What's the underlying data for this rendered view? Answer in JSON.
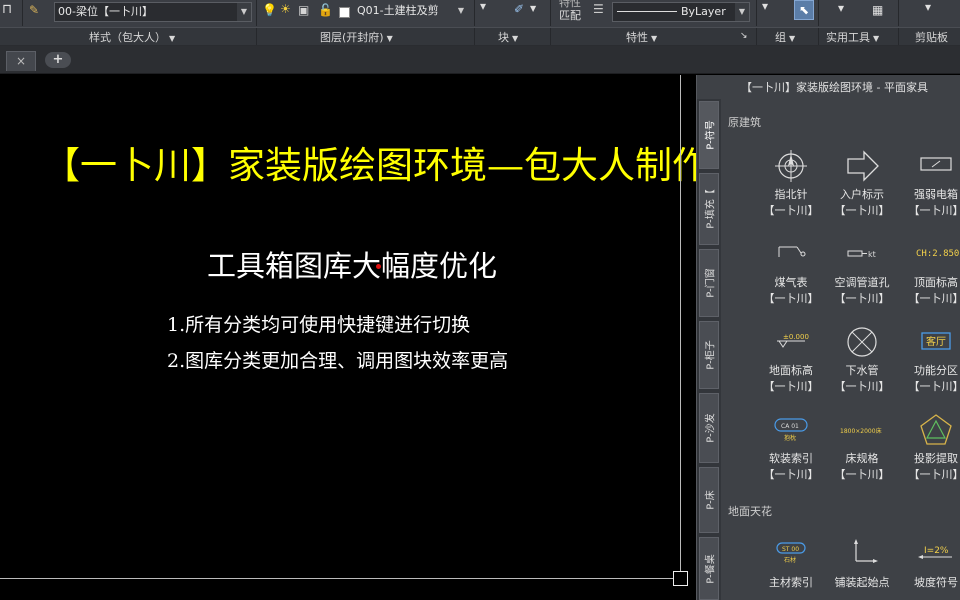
{
  "ribbon": {
    "style_combo": "00-梁位【一卜川】",
    "layer_combo": "Q01-土建柱及剪",
    "bylayer_combo": "ByLayer",
    "match_text1": "特性",
    "match_text2": "匹配",
    "groups": {
      "style": "样式（包大人）",
      "layers": "图层(开封府)",
      "block": "块",
      "properties": "特性",
      "group": "组",
      "utilities": "实用工具",
      "clipboard": "剪贴板"
    }
  },
  "tabs": {
    "close_glyph": "×",
    "add_glyph": "+"
  },
  "canvas": {
    "title": "【一卜川】家装版绘图环境—包大人制作",
    "subtitle": "工具箱图库大幅度优化",
    "lines": [
      "1.所有分类均可使用快捷键进行切换",
      "2.图库分类更加合理、调用图块效率更高"
    ],
    "colors": {
      "title": "#ffff00",
      "body": "#ffffff",
      "background": "#000000"
    }
  },
  "palette": {
    "title": "【一卜川】家装版绘图环境 - 平面家具",
    "vertical_tabs": [
      "P-符号",
      "P-填充【",
      "P-门窗",
      "P-柜子",
      "P-沙发",
      "P-床",
      "P-餐桌"
    ],
    "sections": [
      {
        "label": "原建筑",
        "tools": [
          {
            "name": "指北针",
            "tag": "【一卜川】",
            "icon": "compass-icon"
          },
          {
            "name": "入户标示",
            "tag": "【一卜川】",
            "icon": "arrow-right-icon"
          },
          {
            "name": "强弱电箱",
            "tag": "【一卜川】",
            "icon": "electric-box-icon"
          },
          {
            "name": "煤气表",
            "tag": "【一卜川】",
            "icon": "gas-meter-icon"
          },
          {
            "name": "空调管道孔",
            "tag": "【一卜川】",
            "icon": "ac-pipe-icon",
            "icon_text": "kt"
          },
          {
            "name": "顶面标高",
            "tag": "【一卜川】",
            "icon": "ceiling-level-icon",
            "icon_text": "CH:2.850"
          },
          {
            "name": "地面标高",
            "tag": "【一卜川】",
            "icon": "floor-level-icon",
            "icon_text": "±0.000"
          },
          {
            "name": "下水管",
            "tag": "【一卜川】",
            "icon": "drain-pipe-icon"
          },
          {
            "name": "功能分区",
            "tag": "【一卜川】",
            "icon": "zone-tag-icon",
            "icon_text": "客厅"
          },
          {
            "name": "软装索引",
            "tag": "【一卜川】",
            "icon": "soft-index-icon",
            "icon_text": "CA 01",
            "icon_text2": "抱枕"
          },
          {
            "name": "床规格",
            "tag": "【一卜川】",
            "icon": "bed-spec-icon",
            "icon_text": "1800×2000床"
          },
          {
            "name": "投影提取",
            "tag": "【一卜川】",
            "icon": "projection-icon"
          }
        ]
      },
      {
        "label": "地面天花",
        "tools": [
          {
            "name": "主材索引",
            "tag": "",
            "icon": "material-index-icon",
            "icon_text": "ST 00",
            "icon_text2": "石材"
          },
          {
            "name": "铺装起始点",
            "tag": "",
            "icon": "paving-origin-icon"
          },
          {
            "name": "坡度符号",
            "tag": "",
            "icon": "slope-icon",
            "icon_text": "I=2%"
          }
        ]
      }
    ]
  }
}
